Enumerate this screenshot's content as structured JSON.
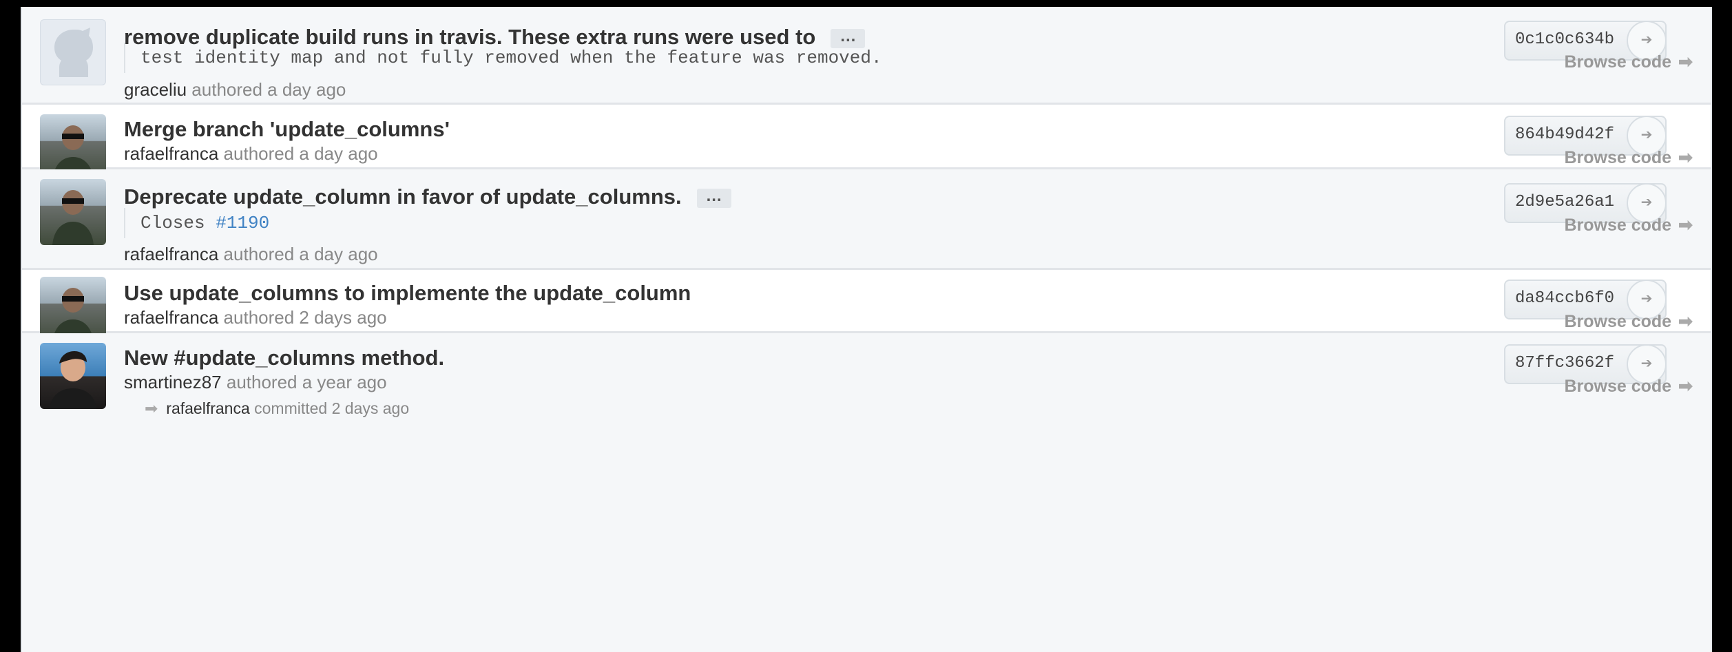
{
  "commits": [
    {
      "title": "remove duplicate build runs in travis. These extra runs were used to",
      "has_more": true,
      "more_label": "…",
      "description": "test identity map and not fully removed when the feature was removed.",
      "author": "graceliu",
      "authored_text": "authored a day ago",
      "sha": "0c1c0c634b",
      "browse_label": "Browse code",
      "avatar": "octocat-icon"
    },
    {
      "title": "Merge branch 'update_columns'",
      "author": "rafaelfranca",
      "authored_text": "authored a day ago",
      "sha": "864b49d42f",
      "browse_label": "Browse code",
      "avatar": "user-photo"
    },
    {
      "title": "Deprecate update_column in favor of update_columns.",
      "has_more": true,
      "more_label": "…",
      "description_prefix": "Closes",
      "description_link": "#1190",
      "author": "rafaelfranca",
      "authored_text": "authored a day ago",
      "sha": "2d9e5a26a1",
      "browse_label": "Browse code",
      "avatar": "user-photo"
    },
    {
      "title": "Use update_columns to implemente the update_column",
      "author": "rafaelfranca",
      "authored_text": "authored 2 days ago",
      "sha": "da84ccb6f0",
      "browse_label": "Browse code",
      "avatar": "user-photo"
    },
    {
      "title": "New #update_columns method.",
      "author": "smartinez87",
      "authored_text": "authored a year ago",
      "committer": "rafaelfranca",
      "committed_text": "committed 2 days ago",
      "sha": "87ffc3662f",
      "browse_label": "Browse code",
      "avatar": "user-photo"
    }
  ],
  "icons": {
    "sha_go": "arrow-right-icon",
    "browse_arrow": "arrow-right-icon",
    "committed_arrow": "arrow-right-icon"
  }
}
